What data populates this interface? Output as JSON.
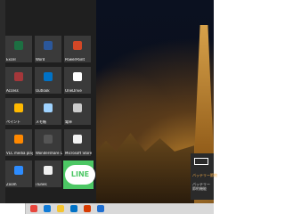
{
  "start_menu": {
    "tiles": [
      {
        "label": "Excel",
        "icon": "excel-icon",
        "color": "#1d6f42",
        "col": 0,
        "row": 0
      },
      {
        "label": "Word",
        "icon": "word-icon",
        "color": "#2b579a",
        "col": 1,
        "row": 0
      },
      {
        "label": "PowerPoint",
        "icon": "powerpoint-icon",
        "color": "#d24726",
        "col": 2,
        "row": 0
      },
      {
        "label": "Access",
        "icon": "access-icon",
        "color": "#a4373a",
        "col": 0,
        "row": 1
      },
      {
        "label": "Outlook",
        "icon": "outlook-icon",
        "color": "#0072c6",
        "col": 1,
        "row": 1
      },
      {
        "label": "OneDrive",
        "icon": "onedrive-icon",
        "color": "#ffffff",
        "col": 2,
        "row": 1
      },
      {
        "label": "ペイント",
        "icon": "paint-icon",
        "color": "#ffb900",
        "col": 0,
        "row": 2
      },
      {
        "label": "メモ帳",
        "icon": "notepad-icon",
        "color": "#9fd3ff",
        "col": 1,
        "row": 2
      },
      {
        "label": "電卓",
        "icon": "calculator-icon",
        "color": "#cccccc",
        "col": 2,
        "row": 2
      },
      {
        "label": "VLC media player",
        "icon": "vlc-icon",
        "color": "#ff8800",
        "col": 0,
        "row": 3
      },
      {
        "label": "Wondershare DVD Memory",
        "icon": "dvd-memory-icon",
        "color": "#555555",
        "col": 1,
        "row": 3
      },
      {
        "label": "Microsoft Store",
        "icon": "store-icon",
        "color": "#f2f2f2",
        "col": 2,
        "row": 3
      },
      {
        "label": "Zoom",
        "icon": "zoom-icon",
        "color": "#2d8cff",
        "col": 0,
        "row": 4
      },
      {
        "label": "iTunes",
        "icon": "itunes-icon",
        "color": "#f0f0f0",
        "col": 1,
        "row": 4
      }
    ],
    "line_tile": {
      "label": "LINE",
      "color": "#4cc764"
    }
  },
  "toast": {
    "title": "バッテリー節約",
    "text": "バッテリー節約機能",
    "icon": "battery-icon"
  },
  "taskbar": {
    "icons": [
      {
        "name": "chrome-icon",
        "color": "#e8453c"
      },
      {
        "name": "edge-icon",
        "color": "#0f7bd8"
      },
      {
        "name": "file-explorer-icon",
        "color": "#f4c430"
      },
      {
        "name": "mail-icon",
        "color": "#0072c6"
      },
      {
        "name": "office-icon",
        "color": "#d83b01"
      },
      {
        "name": "onedrive-taskbar-icon",
        "color": "#1f6fd1"
      }
    ]
  }
}
